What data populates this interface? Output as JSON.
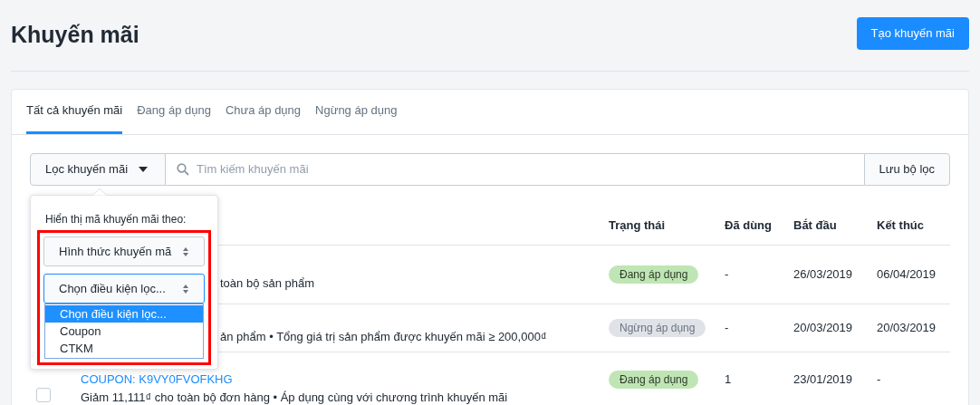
{
  "page": {
    "title": "Khuyến mãi",
    "create_button": "Tạo khuyến mãi"
  },
  "tabs": [
    {
      "label": "Tất cả khuyến mãi",
      "selected": true
    },
    {
      "label": "Đang áp dụng",
      "selected": false
    },
    {
      "label": "Chưa áp dụng",
      "selected": false
    },
    {
      "label": "Ngừng áp dụng",
      "selected": false
    }
  ],
  "filter": {
    "dropdown_label": "Lọc khuyến mãi",
    "search_placeholder": "Tìm kiếm khuyến mãi",
    "save_button": "Lưu bộ lọc"
  },
  "popover": {
    "label": "Hiển thị mã khuyến mãi theo:",
    "selects": [
      {
        "value": "Hình thức khuyến mã",
        "focused": false
      },
      {
        "value": "Chọn điều kiện lọc...",
        "focused": true
      }
    ],
    "options": [
      {
        "label": "Chọn điều kiện lọc...",
        "selected": true
      },
      {
        "label": "Coupon",
        "selected": false
      },
      {
        "label": "CTKM",
        "selected": false
      }
    ]
  },
  "table": {
    "columns": [
      "Trạng thái",
      "Đã dùng",
      "Bắt đầu",
      "Kết thúc"
    ],
    "rows": [
      {
        "description": "toàn bộ sản phẩm",
        "status": {
          "label": "Đang áp dụng",
          "kind": "active"
        },
        "used": "-",
        "start": "26/03/2019",
        "end": "06/04/2019"
      },
      {
        "description": "ản phẩm • Tổng giá trị sản phẩm được khuyến mãi ≥ 200,000₫",
        "status": {
          "label": "Ngừng áp dụng",
          "kind": "stopped"
        },
        "used": "-",
        "start": "20/03/2019",
        "end": "20/03/2019"
      },
      {
        "checked": false,
        "code_label": "COUPON:",
        "code": "K9VY0FVOFKHG",
        "description": "Giảm 11,111₫ cho toàn bộ đơn hàng • Áp dụng cùng với chương trình khuyến mãi",
        "status": {
          "label": "Đang áp dụng",
          "kind": "active"
        },
        "used": "1",
        "start": "23/01/2019",
        "end": "-"
      }
    ]
  }
}
